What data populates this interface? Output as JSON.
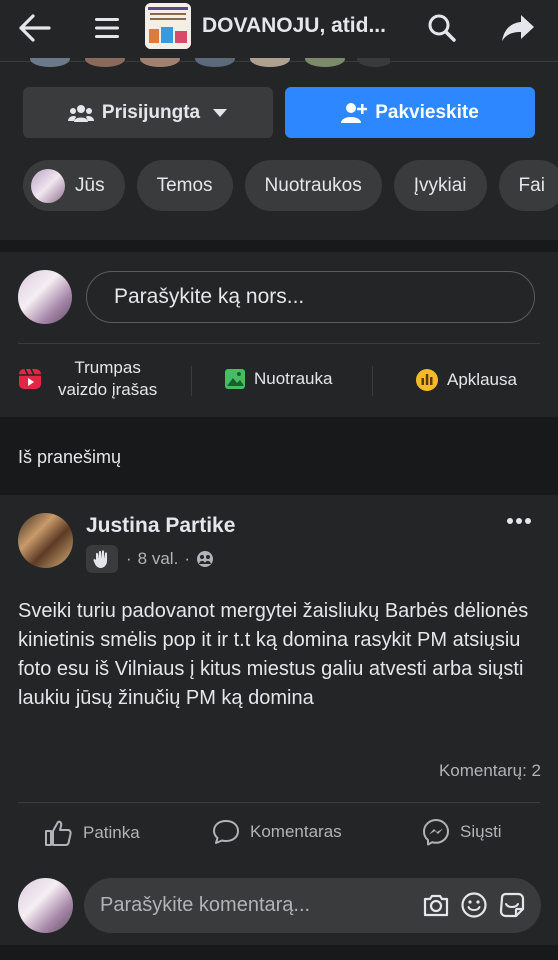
{
  "topbar": {
    "title": "DOVANOJU, atid...",
    "back_icon": "arrow-left-icon",
    "menu_icon": "hamburger-icon",
    "search_icon": "search-icon",
    "share_icon": "share-arrow-icon"
  },
  "header": {
    "joined_label": "Prisijungta",
    "invite_label": "Pakvieskite",
    "chips": [
      "Jūs",
      "Temos",
      "Nuotraukos",
      "Įvykiai",
      "Fai"
    ]
  },
  "composer": {
    "placeholder": "Parašykite ką nors...",
    "reel_label_line1": "Trumpas",
    "reel_label_line2": "vaizdo įrašas",
    "photo_label": "Nuotrauka",
    "poll_label": "Apklausa"
  },
  "feed": {
    "section_label": "Iš pranešimų"
  },
  "post": {
    "author": "Justina Partike",
    "time": "8 val.",
    "text": "Sveiki turiu padovanot mergytei žaisliukų Barbės dėlionės kinietinis smėlis pop it ir t.t  ką domina rasykit PM atsiųsiu foto esu iš Vilniaus į kitus miestus galiu atvesti arba siųsti laukiu jūsų žinučių PM ką domina",
    "comments_count": "Komentarų: 2",
    "like_label": "Patinka",
    "comment_label": "Komentaras",
    "send_label": "Siųsti",
    "comment_placeholder": "Parašykite komentarą..."
  },
  "colors": {
    "background": "#18191a",
    "surface": "#242526",
    "accent": "#2d88ff",
    "text": "#e4e6eb",
    "secondary_text": "#b0b3b8"
  }
}
